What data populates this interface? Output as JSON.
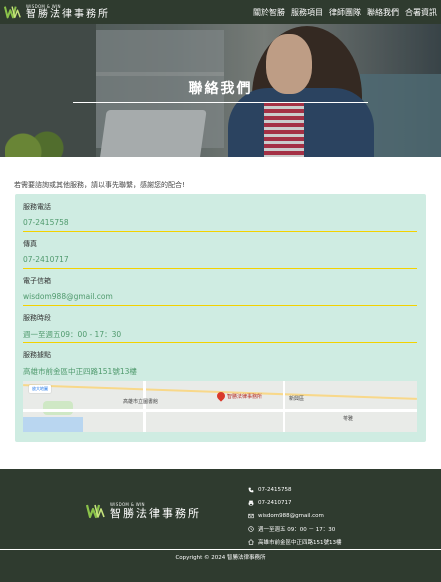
{
  "nav": {
    "brand_en": "WISDOM & WIN",
    "brand_cn": "智勝法律事務所",
    "items": [
      "關於智勝",
      "服務項目",
      "律師團隊",
      "聯絡我們",
      "合署資訊"
    ]
  },
  "hero": {
    "title": "聯絡我們"
  },
  "intro": "若需要諮詢或其他服務，請以事先聯繫，感謝您的配合!",
  "contact_card": {
    "phone_label": "服務電話",
    "phone_value": "07-2415758",
    "fax_label": "傳真",
    "fax_value": "07-2410717",
    "email_label": "電子信箱",
    "email_value": "wisdom988@gmail.com",
    "hours_label": "服務時段",
    "hours_value": "週一至週五09：00 - 17：30",
    "address_label": "服務據點",
    "address_value": "高雄市前金區中正四路151號13樓"
  },
  "map": {
    "view_button": "放大地圖",
    "pin_label": "智勝法律事務所",
    "places": [
      "高雄市立圖書館",
      "新興區",
      "苓雅"
    ]
  },
  "footer": {
    "brand_en": "WISDOM & WIN",
    "brand_cn": "智勝法律事務所",
    "phone": "07-2415758",
    "fax": "07-2410717",
    "email": "wisdom988@gmail.com",
    "hours": "週一至週五 09：00 － 17：30",
    "address": "高雄市前金區中正四路151號13樓",
    "copyright": "Copyright © 2024 智勝法律事務所"
  },
  "colors": {
    "dark_green": "#2f3b2f",
    "logo_green": "#8bc34a",
    "card_bg": "#cfece2",
    "value_green": "#4f9a6d",
    "divider_yellow": "#f3d200"
  }
}
